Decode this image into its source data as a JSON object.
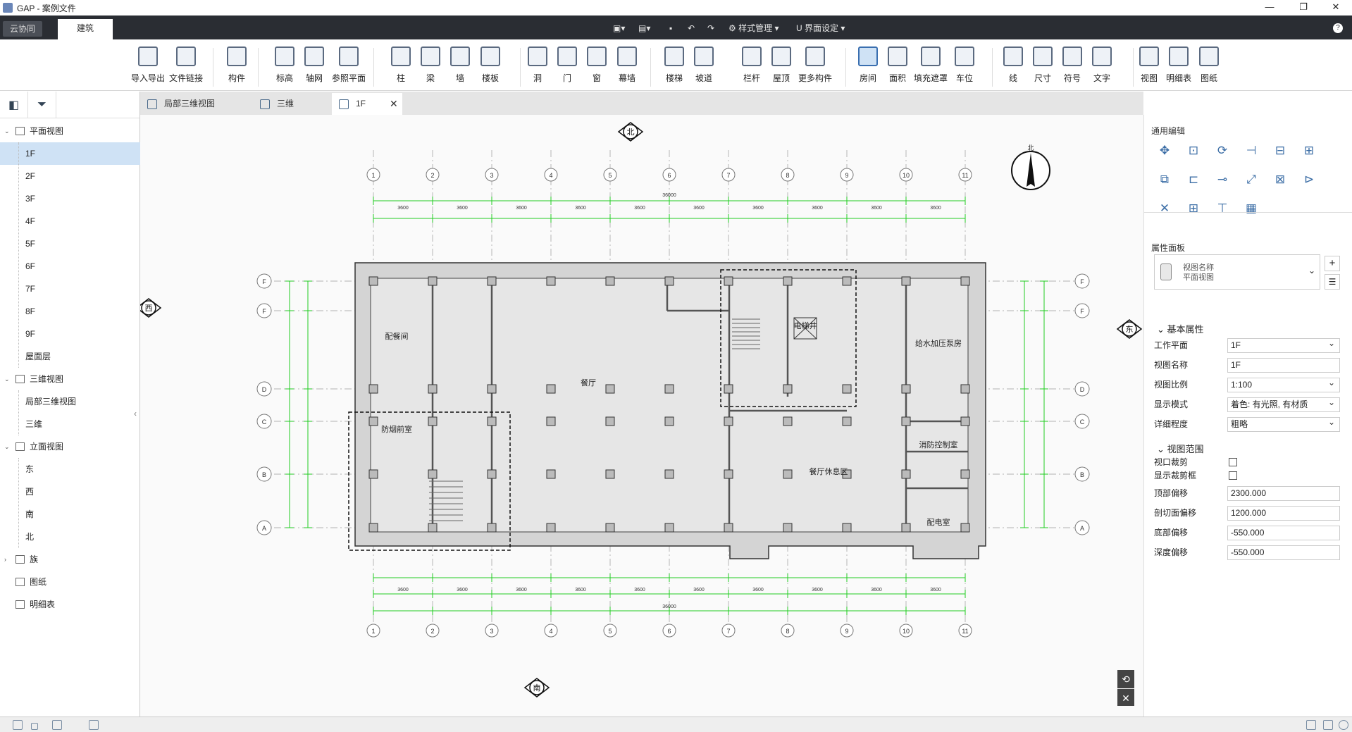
{
  "window": {
    "title": "GAP - 案例文件",
    "buttons": [
      "—",
      "❐",
      "✕"
    ]
  },
  "tabs": {
    "cloud": "云协同",
    "build": "建筑"
  },
  "quick": {
    "style": "样式管理",
    "ui": "界面设定",
    "help": "?"
  },
  "ribbon": [
    "导入导出",
    "文件链接",
    "构件",
    "标高",
    "轴网",
    "参照平面",
    "柱",
    "梁",
    "墙",
    "楼板",
    "洞",
    "门",
    "窗",
    "幕墙",
    "楼梯",
    "坡道",
    "栏杆",
    "屋顶",
    "更多构件",
    "房间",
    "面积",
    "填充遮罩",
    "车位",
    "线",
    "尺寸",
    "符号",
    "文字",
    "视图",
    "明细表",
    "图纸"
  ],
  "tree": {
    "plan": "平面视图",
    "floors": [
      "1F",
      "2F",
      "3F",
      "4F",
      "5F",
      "6F",
      "7F",
      "8F",
      "9F",
      "屋面层"
    ],
    "threeD": "三维视图",
    "threeDItems": [
      "局部三维视图",
      "三维"
    ],
    "elev": "立面视图",
    "elevItems": [
      "东",
      "西",
      "南",
      "北"
    ],
    "family": "族",
    "sheets": "图纸",
    "schedule": "明细表"
  },
  "doctabs": [
    "局部三维视图",
    "三维",
    "1F"
  ],
  "canvas": {
    "dirs": {
      "north": "北",
      "south": "南",
      "east": "东",
      "west": "西"
    },
    "compass": "北",
    "grid_x": [
      "1",
      "2",
      "3",
      "4",
      "5",
      "6",
      "7",
      "8",
      "9",
      "10",
      "11"
    ],
    "grid_y": [
      "F",
      "F",
      "D",
      "C",
      "B",
      "A"
    ],
    "rooms": [
      "配餐间",
      "餐厅",
      "防烟前室",
      "给水加压泵房",
      "电梯井",
      "消防控制室",
      "餐厅休息区",
      "配电室"
    ],
    "top_dims": [
      "3600",
      "3600",
      "3600",
      "3600",
      "3600",
      "3600",
      "3600",
      "3600",
      "3600",
      "3600"
    ],
    "total": "36000"
  },
  "right": {
    "edit_title": "通用编辑",
    "edit_icons": [
      "✥",
      "⊡",
      "⟳",
      "⊣",
      "⊟",
      "⊞",
      "⧉",
      "⊏",
      "⊸",
      "⤢",
      "⊠",
      "⊳",
      "✕",
      "⊞",
      "⊤",
      "▦"
    ],
    "prop_title": "属性面板",
    "view_type": [
      "视图名称",
      "平面视图"
    ],
    "basic": "基本属性",
    "props": [
      [
        "工作平面",
        "1F",
        true
      ],
      [
        "视图名称",
        "1F",
        false
      ],
      [
        "视图比例",
        "1:100",
        true
      ],
      [
        "显示模式",
        "着色: 有光照, 有材质",
        true
      ],
      [
        "详细程度",
        "粗略",
        true
      ]
    ],
    "range": "视图范围",
    "checks": [
      "视口裁剪",
      "显示裁剪框"
    ],
    "offsets": [
      [
        "顶部偏移",
        "2300.000"
      ],
      [
        "剖切面偏移",
        "1200.000"
      ],
      [
        "底部偏移",
        "-550.000"
      ],
      [
        "深度偏移",
        "-550.000"
      ]
    ]
  }
}
